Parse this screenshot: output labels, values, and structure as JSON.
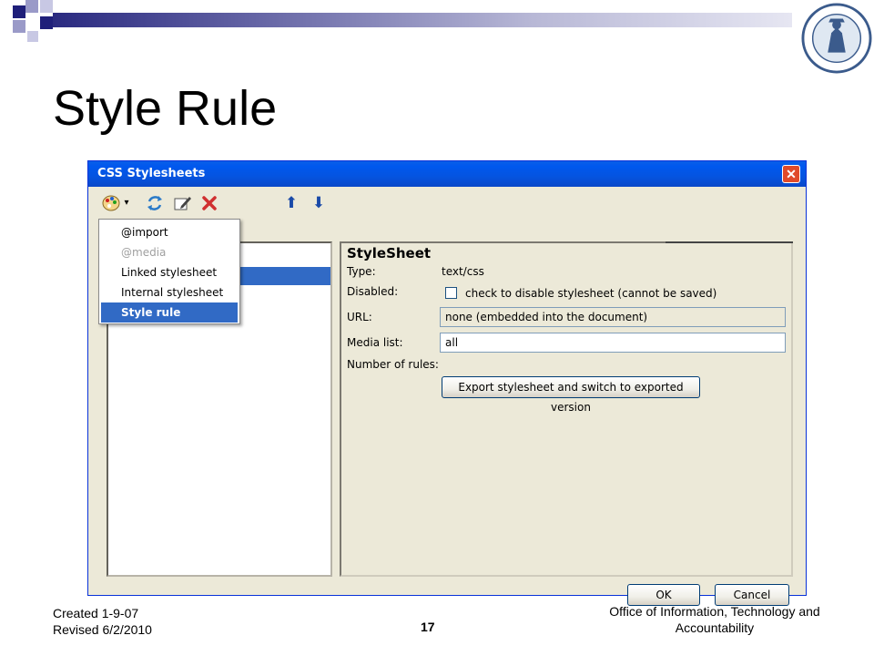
{
  "slide": {
    "title": "Style Rule",
    "footer_left_line1": "Created 1-9-07",
    "footer_left_line2": "Revised 6/2/2010",
    "page_number": "17",
    "footer_right": "Office of Information, Technology and Accountability"
  },
  "logo": {
    "icon": "school-seal-icon"
  },
  "dialog": {
    "title": "CSS Stylesheets",
    "toolbar": {
      "icons": [
        "palette-icon",
        "dropdown-arrow-icon",
        "refresh-icon",
        "edit-icon",
        "delete-icon",
        "arrow-up-icon",
        "arrow-down-icon"
      ]
    },
    "menu": {
      "items": [
        {
          "label": "@import",
          "disabled": false
        },
        {
          "label": "@media",
          "disabled": true
        },
        {
          "label": "Linked stylesheet",
          "disabled": false
        },
        {
          "label": "Internal stylesheet",
          "disabled": false
        },
        {
          "label": "Style rule",
          "disabled": false,
          "selected": true
        }
      ]
    },
    "stylesheet": {
      "heading": "StyleSheet",
      "type_label": "Type:",
      "type_value": "text/css",
      "disabled_label": "Disabled:",
      "disabled_checkbox_text": "check to disable stylesheet (cannot be saved)",
      "url_label": "URL:",
      "url_value": "none (embedded into the document)",
      "media_label": "Media list:",
      "media_value": "all",
      "rules_label": "Number of rules:",
      "export_button": "Export stylesheet and switch to exported version"
    },
    "ok_button": "OK",
    "cancel_button": "Cancel"
  },
  "colors": {
    "titlebar": "#0058ee",
    "selection": "#316ac5",
    "dialog_bg": "#ece9d8",
    "close": "#e04a2a"
  }
}
